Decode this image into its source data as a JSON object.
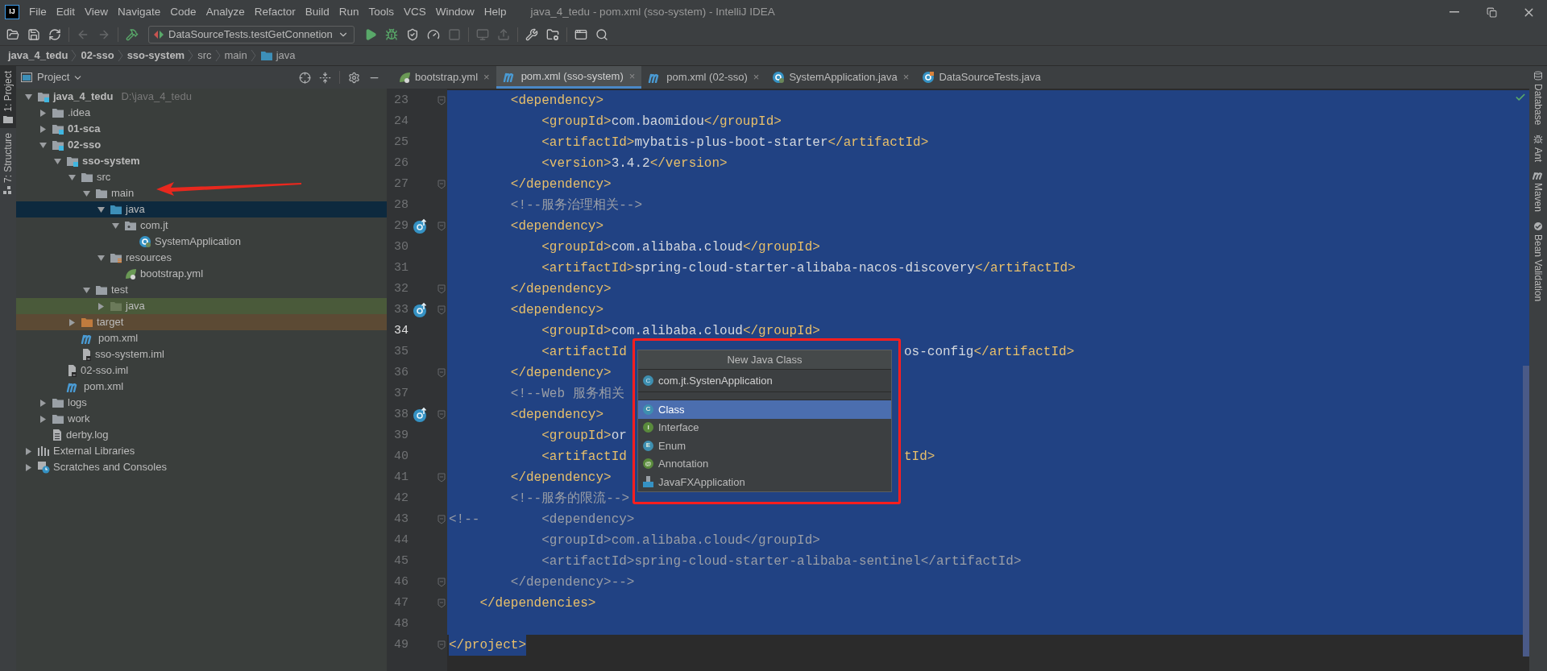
{
  "app_icon": "IJ",
  "menu": [
    "File",
    "Edit",
    "View",
    "Navigate",
    "Code",
    "Analyze",
    "Refactor",
    "Build",
    "Run",
    "Tools",
    "VCS",
    "Window",
    "Help"
  ],
  "window": {
    "title": "java_4_tedu - pom.xml (sso-system) - IntelliJ IDEA"
  },
  "toolbar": {
    "left": [
      {
        "kind": "open",
        "disabled": false
      },
      {
        "kind": "save",
        "disabled": false
      },
      {
        "kind": "sync",
        "disabled": false
      },
      {
        "kind": "back",
        "disabled": true
      },
      {
        "kind": "forward",
        "disabled": true
      },
      {
        "kind": "build",
        "disabled": false
      }
    ],
    "run_config": "DataSourceTests.testGetConnetion",
    "right": [
      {
        "kind": "run",
        "disabled": false
      },
      {
        "kind": "debug",
        "disabled": false
      },
      {
        "kind": "coverage",
        "disabled": false
      },
      {
        "kind": "profile",
        "disabled": false
      },
      {
        "kind": "stop",
        "disabled": true
      },
      {
        "kind": "attach",
        "disabled": true
      },
      {
        "kind": "deploy",
        "disabled": true
      },
      {
        "kind": "settings",
        "disabled": false
      },
      {
        "kind": "structure",
        "disabled": false
      },
      {
        "kind": "window",
        "disabled": false
      },
      {
        "kind": "search",
        "disabled": false
      }
    ]
  },
  "breadcrumb": [
    {
      "label": "java_4_tedu",
      "kind": "module"
    },
    {
      "label": "02-sso",
      "kind": "module"
    },
    {
      "label": "sso-system",
      "kind": "module"
    },
    {
      "label": "src",
      "kind": "plain"
    },
    {
      "label": "main",
      "kind": "plain"
    },
    {
      "label": "java",
      "kind": "source"
    }
  ],
  "left_stripe": [
    {
      "label": "1: Project",
      "kind": "project",
      "selected": true
    },
    {
      "label": "7: Structure",
      "kind": "structure",
      "selected": false
    }
  ],
  "project_panel": {
    "title": "Project",
    "tree": [
      {
        "label": "java_4_tedu",
        "path": "D:\\java_4_tedu",
        "kind": "module",
        "expanded": true,
        "selected": false,
        "children": [
          {
            "label": ".idea",
            "kind": "folder",
            "expanded": false,
            "selected": false
          },
          {
            "label": "01-sca",
            "kind": "module",
            "expanded": false,
            "selected": false
          },
          {
            "label": "02-sso",
            "kind": "module",
            "expanded": true,
            "selected": false,
            "children": [
              {
                "label": "sso-system",
                "kind": "module",
                "expanded": true,
                "selected": false,
                "children": [
                  {
                    "label": "src",
                    "kind": "folder",
                    "expanded": true,
                    "selected": false,
                    "children": [
                      {
                        "label": "main",
                        "kind": "folder",
                        "expanded": true,
                        "selected": false,
                        "children": [
                          {
                            "label": "java",
                            "kind": "source",
                            "expanded": true,
                            "selected": true,
                            "children": [
                              {
                                "label": "com.jt",
                                "kind": "package",
                                "expanded": true,
                                "selected": false,
                                "children": [
                                  {
                                    "label": "SystemApplication",
                                    "kind": "spring-class",
                                    "selected": false
                                  }
                                ]
                              }
                            ]
                          },
                          {
                            "label": "resources",
                            "kind": "resources",
                            "expanded": true,
                            "selected": false,
                            "children": [
                              {
                                "label": "bootstrap.yml",
                                "kind": "yml",
                                "selected": false
                              }
                            ]
                          }
                        ]
                      },
                      {
                        "label": "test",
                        "kind": "folder",
                        "expanded": true,
                        "selected": false,
                        "children": [
                          {
                            "label": "java",
                            "kind": "test-root",
                            "expanded": false,
                            "selected": false
                          }
                        ]
                      }
                    ]
                  },
                  {
                    "label": "target",
                    "kind": "excluded",
                    "expanded": false,
                    "selected": false
                  },
                  {
                    "label": "pom.xml",
                    "kind": "maven",
                    "selected": false
                  },
                  {
                    "label": "sso-system.iml",
                    "kind": "iml",
                    "selected": false
                  }
                ]
              },
              {
                "label": "02-sso.iml",
                "kind": "iml",
                "selected": false
              },
              {
                "label": "pom.xml",
                "kind": "maven",
                "selected": false
              }
            ]
          },
          {
            "label": "logs",
            "kind": "folder",
            "expanded": false,
            "selected": false
          },
          {
            "label": "work",
            "kind": "folder",
            "expanded": false,
            "selected": false
          },
          {
            "label": "derby.log",
            "kind": "log",
            "selected": false
          }
        ]
      },
      {
        "label": "External Libraries",
        "kind": "libraries",
        "expanded": false,
        "selected": false
      },
      {
        "label": "Scratches and Consoles",
        "kind": "scratches",
        "expanded": false,
        "selected": false
      }
    ]
  },
  "tabs": [
    {
      "label": "bootstrap.yml",
      "kind": "yml",
      "selected": false,
      "close": "×"
    },
    {
      "label": "pom.xml (sso-system)",
      "kind": "maven",
      "selected": true,
      "close": "×"
    },
    {
      "label": "pom.xml (02-sso)",
      "kind": "maven",
      "selected": false,
      "close": "×"
    },
    {
      "label": "SystemApplication.java",
      "kind": "spring-class",
      "selected": false,
      "close": "×"
    },
    {
      "label": "DataSourceTests.java",
      "kind": "test-class",
      "selected": false
    }
  ],
  "editor": {
    "lines": [
      {
        "number": "23",
        "fold": true,
        "mark": false,
        "current": false,
        "kind": "selected-line",
        "segments": [
          {
            "kind": "tag",
            "text": "        <dependency>"
          }
        ]
      },
      {
        "number": "24",
        "fold": false,
        "mark": false,
        "current": false,
        "kind": "selected-line",
        "segments": [
          {
            "kind": "tag",
            "text": "            <groupId>"
          },
          {
            "kind": "text",
            "text": "com.baomidou"
          },
          {
            "kind": "tag",
            "text": "</groupId>"
          }
        ]
      },
      {
        "number": "25",
        "fold": false,
        "mark": false,
        "current": false,
        "kind": "selected-line",
        "segments": [
          {
            "kind": "tag",
            "text": "            <artifactId>"
          },
          {
            "kind": "text",
            "text": "mybatis-plus-boot-starter"
          },
          {
            "kind": "tag",
            "text": "</artifactId>"
          }
        ]
      },
      {
        "number": "26",
        "fold": false,
        "mark": false,
        "current": false,
        "kind": "selected-line",
        "segments": [
          {
            "kind": "tag",
            "text": "            <version>"
          },
          {
            "kind": "text",
            "text": "3.4.2"
          },
          {
            "kind": "tag",
            "text": "</version>"
          }
        ]
      },
      {
        "number": "27",
        "fold": true,
        "mark": false,
        "current": false,
        "kind": "selected-line",
        "segments": [
          {
            "kind": "tag",
            "text": "        </dependency>"
          }
        ]
      },
      {
        "number": "28",
        "fold": false,
        "mark": false,
        "current": false,
        "kind": "selected-line",
        "segments": [
          {
            "kind": "comment",
            "text": "        <!--服务治理相关-->"
          }
        ]
      },
      {
        "number": "29",
        "fold": true,
        "mark": true,
        "current": false,
        "kind": "selected-line",
        "segments": [
          {
            "kind": "tag",
            "text": "        <dependency>"
          }
        ]
      },
      {
        "number": "30",
        "fold": false,
        "mark": false,
        "current": false,
        "kind": "selected-line",
        "segments": [
          {
            "kind": "tag",
            "text": "            <groupId>"
          },
          {
            "kind": "text",
            "text": "com.alibaba.cloud"
          },
          {
            "kind": "tag",
            "text": "</groupId>"
          }
        ]
      },
      {
        "number": "31",
        "fold": false,
        "mark": false,
        "current": false,
        "kind": "selected-line",
        "segments": [
          {
            "kind": "tag",
            "text": "            <artifactId>"
          },
          {
            "kind": "text",
            "text": "spring-cloud-starter-alibaba-nacos-discovery"
          },
          {
            "kind": "tag",
            "text": "</artifactId>"
          }
        ]
      },
      {
        "number": "32",
        "fold": true,
        "mark": false,
        "current": false,
        "kind": "selected-line",
        "segments": [
          {
            "kind": "tag",
            "text": "        </dependency>"
          }
        ]
      },
      {
        "number": "33",
        "fold": true,
        "mark": true,
        "current": false,
        "kind": "selected-line",
        "segments": [
          {
            "kind": "tag",
            "text": "        <dependency>"
          }
        ]
      },
      {
        "number": "34",
        "fold": false,
        "mark": false,
        "current": true,
        "kind": "selected-line",
        "segments": [
          {
            "kind": "tag",
            "text": "            <groupId>"
          },
          {
            "kind": "text",
            "text": "com.alibaba.cloud"
          },
          {
            "kind": "tag",
            "text": "</groupId>"
          }
        ]
      },
      {
        "number": "35",
        "fold": false,
        "mark": false,
        "current": false,
        "kind": "selected-line",
        "segments": [
          {
            "kind": "tag",
            "text": "            <artifactId"
          }
        ],
        "after": [
          {
            "kind": "text",
            "text": "os-config"
          },
          {
            "kind": "tag",
            "text": "</artifactId>"
          }
        ]
      },
      {
        "number": "36",
        "fold": true,
        "mark": false,
        "current": false,
        "kind": "selected-line",
        "segments": [
          {
            "kind": "tag",
            "text": "        </dependency>"
          }
        ]
      },
      {
        "number": "37",
        "fold": false,
        "mark": false,
        "current": false,
        "kind": "selected-line",
        "segments": [
          {
            "kind": "comment",
            "text": "        <!--Web 服务相关"
          }
        ]
      },
      {
        "number": "38",
        "fold": true,
        "mark": true,
        "current": false,
        "kind": "selected-line",
        "segments": [
          {
            "kind": "tag",
            "text": "        <dependency>"
          }
        ]
      },
      {
        "number": "39",
        "fold": false,
        "mark": false,
        "current": false,
        "kind": "selected-line",
        "segments": [
          {
            "kind": "tag",
            "text": "            <groupId>"
          },
          {
            "kind": "text",
            "text": "or"
          }
        ]
      },
      {
        "number": "40",
        "fold": false,
        "mark": false,
        "current": false,
        "kind": "selected-line",
        "segments": [
          {
            "kind": "tag",
            "text": "            <artifactId"
          }
        ],
        "after": [
          {
            "kind": "tag",
            "text": "tId>"
          }
        ]
      },
      {
        "number": "41",
        "fold": true,
        "mark": false,
        "current": false,
        "kind": "selected-line",
        "segments": [
          {
            "kind": "tag",
            "text": "        </dependency>"
          }
        ]
      },
      {
        "number": "42",
        "fold": false,
        "mark": false,
        "current": false,
        "kind": "selected-line",
        "segments": [
          {
            "kind": "comment",
            "text": "        <!--服务的限流-->"
          }
        ]
      },
      {
        "number": "43",
        "fold": true,
        "mark": false,
        "current": false,
        "kind": "selected-line",
        "segments": [
          {
            "kind": "comment",
            "text": "<!--        <dependency>"
          }
        ]
      },
      {
        "number": "44",
        "fold": false,
        "mark": false,
        "current": false,
        "kind": "selected-line",
        "segments": [
          {
            "kind": "comment",
            "text": "            <groupId>com.alibaba.cloud</groupId>"
          }
        ]
      },
      {
        "number": "45",
        "fold": false,
        "mark": false,
        "current": false,
        "kind": "selected-line",
        "segments": [
          {
            "kind": "comment",
            "text": "            <artifactId>spring-cloud-starter-alibaba-sentinel</artifactId>"
          }
        ]
      },
      {
        "number": "46",
        "fold": true,
        "mark": false,
        "current": false,
        "kind": "selected-line",
        "segments": [
          {
            "kind": "comment",
            "text": "        </dependency>-->"
          }
        ]
      },
      {
        "number": "47",
        "fold": true,
        "mark": false,
        "current": false,
        "kind": "selected-line",
        "segments": [
          {
            "kind": "tag",
            "text": "    </dependencies>"
          }
        ]
      },
      {
        "number": "48",
        "fold": false,
        "mark": false,
        "current": false,
        "kind": "selected-line"
      },
      {
        "number": "49",
        "fold": true,
        "mark": false,
        "current": false,
        "kind": "selected-text",
        "segments": [
          {
            "kind": "tag",
            "text": "</project>"
          }
        ]
      }
    ]
  },
  "popup": {
    "title": "New Java Class",
    "field": {
      "badge": "C",
      "value": "com.jt.SystenApplication"
    },
    "items": [
      {
        "kind": "class",
        "badge": "C",
        "label": "Class",
        "selected": true
      },
      {
        "kind": "interface",
        "badge": "I",
        "label": "Interface",
        "selected": false
      },
      {
        "kind": "enum",
        "badge": "E",
        "label": "Enum",
        "selected": false
      },
      {
        "kind": "annotation",
        "badge": "@",
        "label": "Annotation",
        "selected": false
      },
      {
        "kind": "javafx",
        "label": "JavaFXApplication",
        "selected": false
      }
    ]
  },
  "right_stripe": [
    {
      "label": "Database",
      "kind": "database"
    },
    {
      "label": "Ant",
      "kind": "ant"
    },
    {
      "label": "Maven",
      "kind": "maven"
    },
    {
      "label": "Bean Validation",
      "kind": "bean"
    }
  ]
}
